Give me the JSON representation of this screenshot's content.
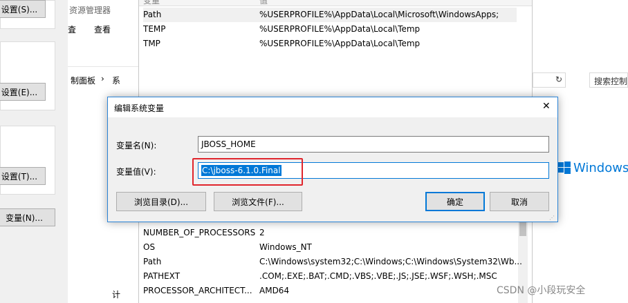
{
  "left_panel": {
    "btn_settings_s": "设置(S)...",
    "btn_settings_e": "设置(E)...",
    "btn_settings_t": "设置(T)...",
    "btn_var_n": "变量(N)..."
  },
  "explorer": {
    "title_fragment": "资源管理器",
    "menu_item_partial": "査",
    "menu_view": "查看",
    "breadcrumb_control_panel": "制面板",
    "breadcrumb_arrow": "›",
    "breadcrumb_next": "系",
    "bottom_char": "计"
  },
  "env_list_top": {
    "header_name": "变量",
    "header_value": "值",
    "rows": [
      {
        "name": "Path",
        "value": "%USERPROFILE%\\AppData\\Local\\Microsoft\\WindowsApps;"
      },
      {
        "name": "TEMP",
        "value": "%USERPROFILE%\\AppData\\Local\\Temp"
      },
      {
        "name": "TMP",
        "value": "%USERPROFILE%\\AppData\\Local\\Temp"
      }
    ]
  },
  "env_list_bottom": {
    "rows": [
      {
        "name": "NUMBER_OF_PROCESSORS",
        "value": "2"
      },
      {
        "name": "OS",
        "value": "Windows_NT"
      },
      {
        "name": "Path",
        "value": "C:\\Windows\\system32;C:\\Windows;C:\\Windows\\System32\\Wb..."
      },
      {
        "name": "PATHEXT",
        "value": ".COM;.EXE;.BAT;.CMD;.VBS;.VBE;.JS;.JSE;.WSF;.WSH;.MSC"
      },
      {
        "name": "PROCESSOR_ARCHITECT...",
        "value": "AMD64"
      }
    ]
  },
  "right_strip": {
    "search_placeholder": "搜索控制",
    "windows_text": "Windows"
  },
  "dialog": {
    "title": "编辑系统变量",
    "close": "✕",
    "name_label": "变量名(N):",
    "name_value": "JBOSS_HOME",
    "value_label": "变量值(V):",
    "value_value": "C:\\jboss-6.1.0.Final",
    "browse_dir": "浏览目录(D)...",
    "browse_file": "浏览文件(F)...",
    "ok": "确定",
    "cancel": "取消"
  },
  "watermark": "CSDN @小段玩安全",
  "colors": {
    "accent": "#0078d7",
    "highlight_box": "#e0242b",
    "windows_blue": "#0078d7"
  }
}
